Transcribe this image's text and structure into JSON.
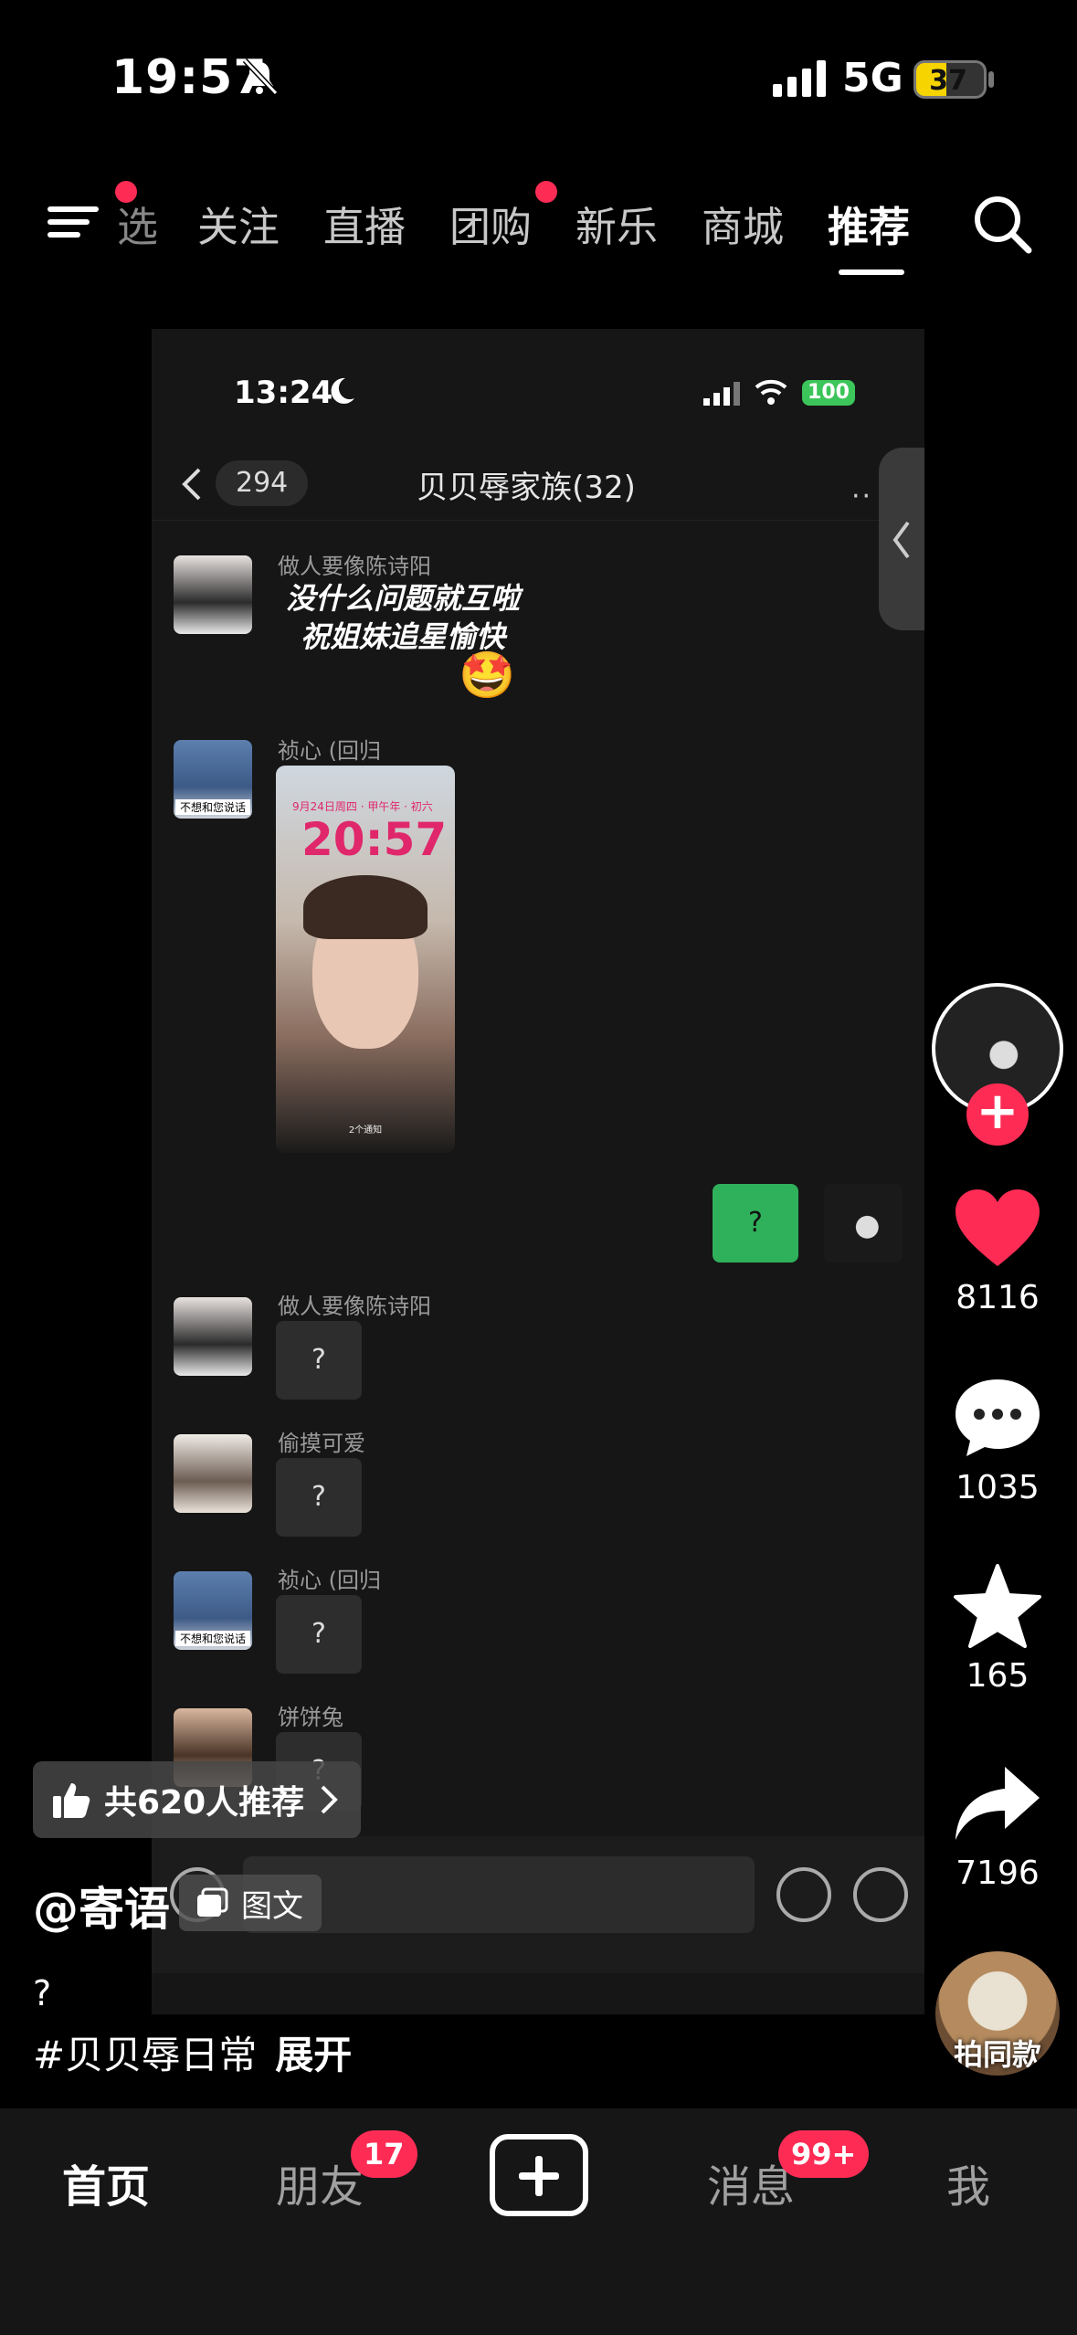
{
  "status_bar": {
    "time": "19:57",
    "network": "5G",
    "battery": "37"
  },
  "top_tabs": [
    {
      "label": "关注"
    },
    {
      "label": "直播"
    },
    {
      "label": "团购"
    },
    {
      "label": "新乐"
    },
    {
      "label": "商城"
    },
    {
      "label": "推荐",
      "active": true
    }
  ],
  "partial_tab": "选",
  "video": {
    "inner_status": {
      "time": "13:24",
      "battery": "100"
    },
    "chat": {
      "back_count": "294",
      "title": "贝贝辱家族(32)",
      "more": "··",
      "messages": [
        {
          "sender": "做人要像陈诗阳",
          "text": "没什么问题就互啦\n祝姐妹追星愉快",
          "emoji": "🤩"
        },
        {
          "sender": "祯心 (回归",
          "avatar_caption": "不想和您说话",
          "image": {
            "date": "9月24日周四 · 甲午年 · 初六",
            "clock": "20:57",
            "footer": "2个通知"
          }
        },
        {
          "sender": "",
          "text": "?",
          "mine": true
        },
        {
          "sender": "做人要像陈诗阳",
          "text": "?"
        },
        {
          "sender": "偷摸可爱",
          "text": "?"
        },
        {
          "sender": "祯心 (回归",
          "avatar_caption": "不想和您说话",
          "text": "?"
        },
        {
          "sender": "饼饼兔",
          "text": "?"
        }
      ]
    }
  },
  "recommend": {
    "label": "共620人推荐"
  },
  "author": "@寄语",
  "post_type": "图文",
  "caption": "?",
  "hashtag": "#贝贝辱日常",
  "expand": "展开",
  "rail": {
    "likes": "8116",
    "comments": "1035",
    "favorites": "165",
    "shares": "7196",
    "same_style": "拍同款"
  },
  "bottom_nav": {
    "home": "首页",
    "friends": "朋友",
    "friends_badge": "17",
    "messages": "消息",
    "messages_badge": "99+",
    "me": "我"
  },
  "colors": {
    "accent": "#fe2c55",
    "bubble_self": "#2fb05a",
    "battery": "#f6d400"
  },
  "icons": [
    "bell-muted-icon",
    "menu-icon",
    "search-icon",
    "heart-icon",
    "comment-icon",
    "star-icon",
    "share-icon",
    "plus-icon",
    "thumbs-up-icon",
    "chevron-right-icon",
    "image-text-icon",
    "moon-icon",
    "wifi-icon",
    "emoji-icon"
  ]
}
